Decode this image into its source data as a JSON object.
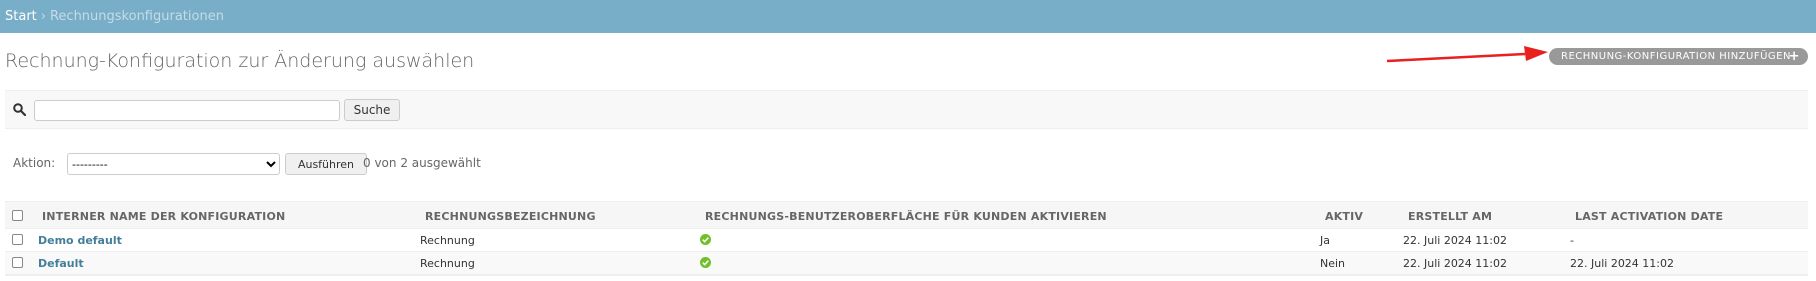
{
  "breadcrumbs": {
    "home": "Start",
    "separator": "›",
    "current": "Rechnungskonfigurationen"
  },
  "page": {
    "title": "Rechnung-Konfiguration zur Änderung auswählen",
    "add_button": "RECHNUNG-KONFIGURATION HINZUFÜGEN"
  },
  "search": {
    "value": "",
    "button": "Suche"
  },
  "actions": {
    "label": "Aktion:",
    "selected": "---------",
    "run_button": "Ausführen",
    "counter": "0 von 2 ausgewählt"
  },
  "table": {
    "headers": [
      "INTERNER NAME DER KONFIGURATION",
      "RECHNUNGSBEZEICHNUNG",
      "RECHNUNGS-BENUTZEROBERFLÄCHE FÜR KUNDEN AKTIVIEREN",
      "AKTIV",
      "ERSTELLT AM",
      "LAST ACTIVATION DATE"
    ],
    "rows": [
      {
        "name": "Demo default",
        "label": "Rechnung",
        "customer_ui": "check-icon",
        "active": "Ja",
        "created": "22. Juli 2024 11:02",
        "last_activation": "-"
      },
      {
        "name": "Default",
        "label": "Rechnung",
        "customer_ui": "check-icon",
        "active": "Nein",
        "created": "22. Juli 2024 11:02",
        "last_activation": "22. Juli 2024 11:02"
      }
    ]
  },
  "colors": {
    "header_bar": "#79aec8",
    "link": "#447e9b",
    "add_button": "#999999",
    "annotation_arrow": "#e8201e",
    "check_ok": "#70bf2b"
  }
}
